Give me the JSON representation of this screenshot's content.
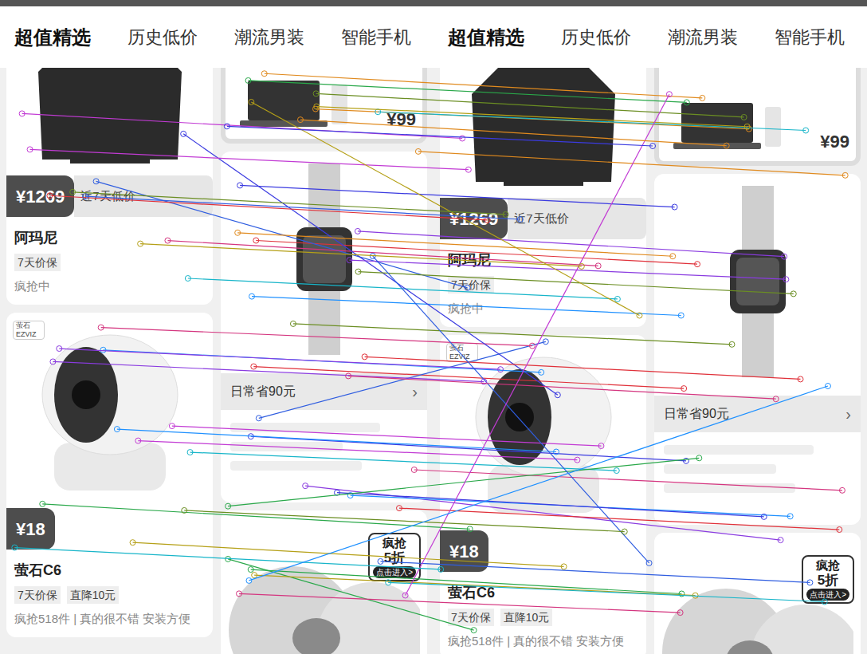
{
  "views": [
    {
      "tabs": [
        {
          "label": "超值精选",
          "selected": true
        },
        {
          "label": "历史低价",
          "selected": false
        },
        {
          "label": "潮流男装",
          "selected": false
        },
        {
          "label": "智能手机",
          "selected": false
        }
      ]
    },
    {
      "tabs": [
        {
          "label": "超值精选",
          "selected": true
        },
        {
          "label": "历史低价",
          "selected": false
        },
        {
          "label": "潮流男装",
          "selected": false
        },
        {
          "label": "智能手机",
          "selected": false
        }
      ]
    }
  ],
  "feed": {
    "left": [
      {
        "image": "sweater",
        "brand": "",
        "price": "¥1269",
        "price_note": "近7天低价",
        "title": "阿玛尼",
        "tags": [
          "7天价保"
        ],
        "status": "疯抢中"
      },
      {
        "image": "camera",
        "brand": "萤石 EZVIZ",
        "price": "¥18",
        "price_note": "",
        "title": "萤石C6",
        "tags": [
          "7天价保",
          "直降10元"
        ],
        "status": "疯抢518件 | 真的很不错 安装方便"
      }
    ],
    "right": [
      {
        "kind": "mini",
        "image": "laptop",
        "price": "¥99"
      },
      {
        "kind": "feature",
        "image": "watch",
        "note": "日常省90元",
        "arrow": "›"
      },
      {
        "kind": "promo",
        "image": "peach",
        "badge_top": "疯抢",
        "badge_main": "5折",
        "button": "点击进入>"
      }
    ]
  }
}
